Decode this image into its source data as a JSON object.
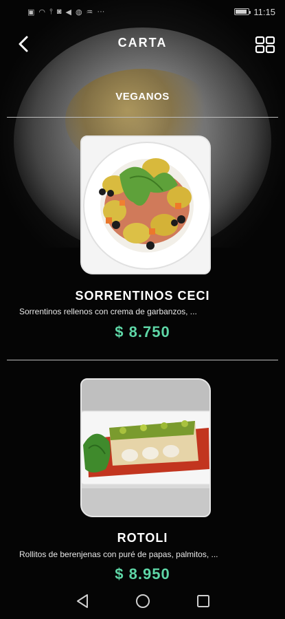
{
  "status_bar": {
    "icons": [
      "sim-icon",
      "wifi-icon",
      "usb-icon",
      "instagram-icon",
      "telegram-icon",
      "whatsapp-icon",
      "twitter-icon",
      "more-icon"
    ],
    "time": "11:15",
    "battery_level": 0.85
  },
  "header": {
    "title": "CARTA"
  },
  "category": {
    "label": "VEGANOS"
  },
  "products": [
    {
      "name": "SORRENTINOS CECI",
      "description": "Sorrentinos rellenos con crema de garbanzos, ...",
      "price": "$ 8.750"
    },
    {
      "name": "ROTOLI",
      "description": "Rollitos de berenjenas con puré de papas, palmitos, ...",
      "price": "$ 8.950"
    }
  ],
  "colors": {
    "price": "#5ed6a6",
    "background": "#050505",
    "text": "#ffffff"
  }
}
